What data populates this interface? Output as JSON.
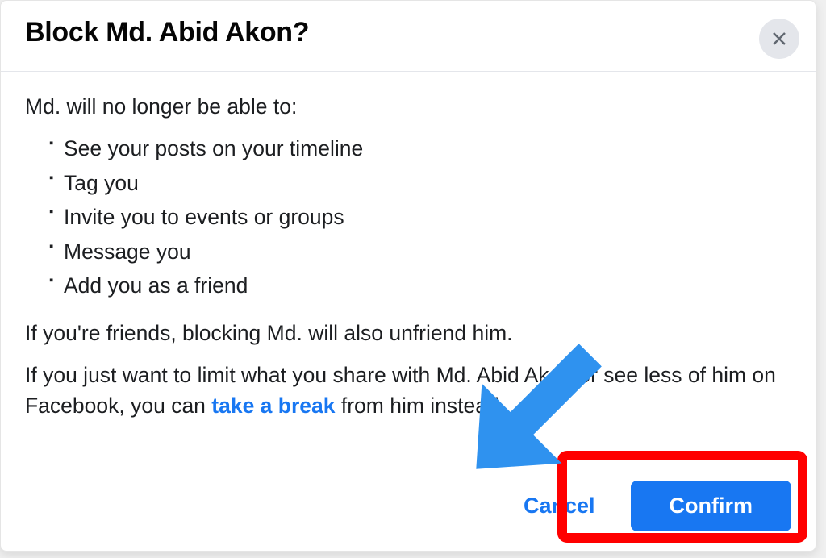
{
  "modal": {
    "title": "Block Md. Abid Akon?",
    "intro": "Md. will no longer be able to:",
    "bullets": [
      "See your posts on your timeline",
      "Tag you",
      "Invite you to events or groups",
      "Message you",
      "Add you as a friend"
    ],
    "para1": "If you're friends, blocking Md. will also unfriend him.",
    "para2_before_name": "If you just want to limit what you share with Md. Abid Akon or see less of him on Facebook, you can ",
    "take_break_label": "take a break",
    "para2_after_link": " from him instead."
  },
  "buttons": {
    "cancel": "Cancel",
    "confirm": "Confirm"
  }
}
